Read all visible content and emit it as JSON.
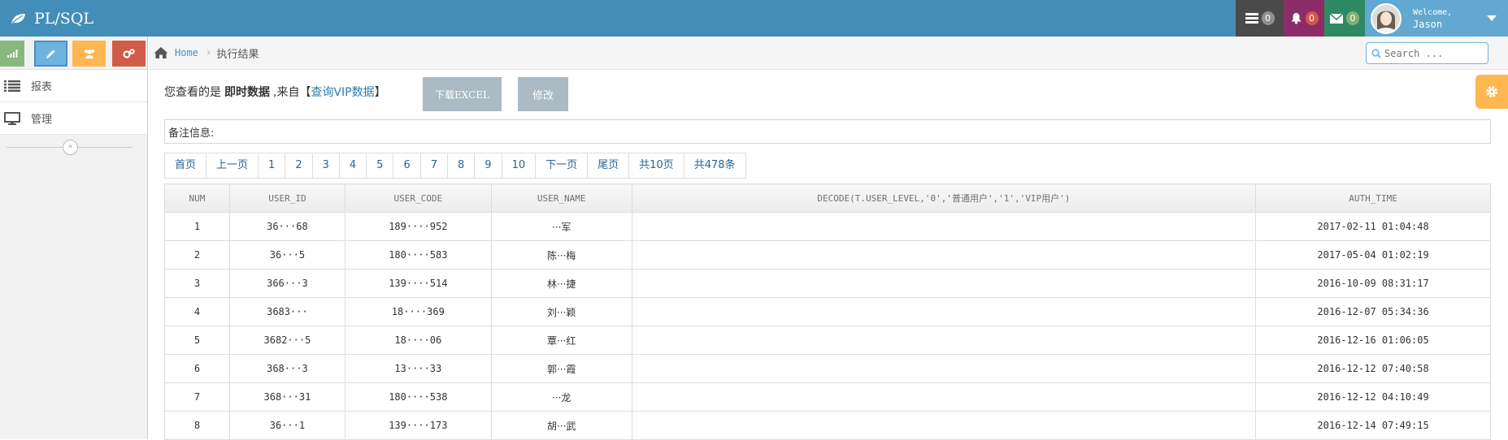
{
  "app": {
    "title": "PL/SQL"
  },
  "navbar": {
    "tasks_count": "0",
    "notifications_count": "0",
    "messages_count": "0",
    "welcome": "Welcome,",
    "user_name": "Jason"
  },
  "breadcrumb": {
    "home": "Home",
    "current": "执行结果"
  },
  "search": {
    "placeholder": "Search ..."
  },
  "sidebar": {
    "items": [
      {
        "label": "报表",
        "icon": "list-icon"
      },
      {
        "label": "管理",
        "icon": "desktop-icon"
      }
    ]
  },
  "info": {
    "prefix": "您查看的是",
    "data_type": "即时数据",
    "from_text": ",来自【",
    "link": "查询VIP数据",
    "suffix": "】"
  },
  "buttons": {
    "download_excel": "下载EXCEL",
    "edit": "修改"
  },
  "remark": {
    "label": "备注信息:"
  },
  "pagination": [
    "首页",
    "上一页",
    "1",
    "2",
    "3",
    "4",
    "5",
    "6",
    "7",
    "8",
    "9",
    "10",
    "下一页",
    "尾页",
    "共10页",
    "共478条"
  ],
  "table": {
    "columns": [
      "NUM",
      "USER_ID",
      "USER_CODE",
      "USER_NAME",
      "DECODE(T.USER_LEVEL,'0','普通用户','1','VIP用户')",
      "AUTH_TIME"
    ],
    "rows": [
      [
        "1",
        "36···68",
        "189····952",
        "···军",
        "",
        "2017-02-11 01:04:48"
      ],
      [
        "2",
        "36···5",
        "180····583",
        "陈···梅",
        "",
        "2017-05-04 01:02:19"
      ],
      [
        "3",
        "366···3",
        "139····514",
        "林···捷",
        "",
        "2016-10-09 08:31:17"
      ],
      [
        "4",
        "3683···",
        "18····369",
        "刘···颖",
        "",
        "2016-12-07 05:34:36"
      ],
      [
        "5",
        "3682···5",
        "18····06",
        "覃···红",
        "",
        "2016-12-16 01:06:05"
      ],
      [
        "6",
        "368···3",
        "13····33",
        "郭···霞",
        "",
        "2016-12-12 07:40:58"
      ],
      [
        "7",
        "368···31",
        "180····538",
        "···龙",
        "",
        "2016-12-12 04:10:49"
      ],
      [
        "8",
        "36···1",
        "139····173",
        "胡···武",
        "",
        "2016-12-14 07:49:15"
      ]
    ]
  },
  "colors": {
    "navbar": "#438eb9",
    "link": "#2a7ab0",
    "button_disabled": "#abbac3",
    "settings": "#ffb752"
  }
}
